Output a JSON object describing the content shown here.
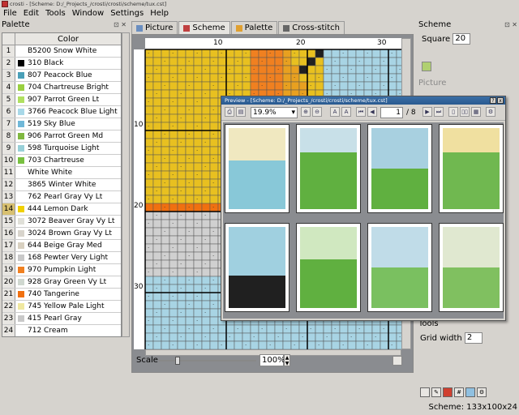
{
  "titlebar": {
    "text": "crosti - [Scheme: D:/_Projects_/crosti/crosti/scheme/tux.cst]"
  },
  "menu": [
    "File",
    "Edit",
    "Tools",
    "Window",
    "Settings",
    "Help"
  ],
  "palette": {
    "title": "Palette",
    "column_header": "Color",
    "selected_row": 14,
    "rows": [
      {
        "n": "1",
        "name": "B5200 Snow White",
        "color": ""
      },
      {
        "n": "2",
        "name": "310 Black",
        "color": "#000000"
      },
      {
        "n": "3",
        "name": "807 Peacock Blue",
        "color": "#4aa0b8"
      },
      {
        "n": "4",
        "name": "704 Chartreuse Bright",
        "color": "#9ad040"
      },
      {
        "n": "5",
        "name": "907 Parrot Green Lt",
        "color": "#b0e060"
      },
      {
        "n": "6",
        "name": "3766 Peacock Blue Light",
        "color": "#a8d8e8"
      },
      {
        "n": "7",
        "name": "519 Sky Blue",
        "color": "#70b8d8"
      },
      {
        "n": "8",
        "name": "906 Parrot Green Md",
        "color": "#80b840"
      },
      {
        "n": "9",
        "name": "598 Turquoise Light",
        "color": "#98d0d8"
      },
      {
        "n": "10",
        "name": "703 Chartreuse",
        "color": "#78c040"
      },
      {
        "n": "11",
        "name": "White White",
        "color": ""
      },
      {
        "n": "12",
        "name": "3865 Winter White",
        "color": ""
      },
      {
        "n": "13",
        "name": "762 Pearl Gray Vy Lt",
        "color": ""
      },
      {
        "n": "14",
        "name": "444 Lemon Dark",
        "color": "#f0d000"
      },
      {
        "n": "15",
        "name": "3072 Beaver Gray Vy Lt",
        "color": "#e0e0d8"
      },
      {
        "n": "16",
        "name": "3024 Brown Gray Vy Lt",
        "color": "#d8d4cc"
      },
      {
        "n": "17",
        "name": "644 Beige Gray Med",
        "color": "#d8d0c0"
      },
      {
        "n": "18",
        "name": "168 Pewter Very Light",
        "color": "#c8c8c8"
      },
      {
        "n": "19",
        "name": "970 Pumpkin Light",
        "color": "#f08020"
      },
      {
        "n": "20",
        "name": "928 Gray Green Vy Lt",
        "color": "#d0d8d0"
      },
      {
        "n": "21",
        "name": "740 Tangerine",
        "color": "#f07010"
      },
      {
        "n": "22",
        "name": "745 Yellow Pale Light",
        "color": "#f0e8a0"
      },
      {
        "n": "23",
        "name": "415 Pearl Gray",
        "color": "#c8c8c8"
      },
      {
        "n": "24",
        "name": "712 Cream",
        "color": ""
      }
    ]
  },
  "tabs": [
    {
      "label": "Picture",
      "icon": "picture-icon",
      "color": "#6a8ec0"
    },
    {
      "label": "Scheme",
      "icon": "scheme-icon",
      "color": "#c04040"
    },
    {
      "label": "Palette",
      "icon": "palette-icon",
      "color": "#e0a030"
    },
    {
      "label": "Cross-stitch",
      "icon": "cross-stitch-icon",
      "color": "#666666"
    }
  ],
  "active_tab": 1,
  "rulers": {
    "top": [
      "10",
      "20",
      "30"
    ],
    "left": [
      "10",
      "20",
      "30"
    ]
  },
  "scale": {
    "label": "Scale",
    "value": "100%"
  },
  "right": {
    "scheme_title": "Scheme",
    "square_label": "Square",
    "square_value": "20",
    "picture_title": "Picture",
    "tools_title": "Tools",
    "grid_width_label": "Grid width",
    "grid_width_value": "2"
  },
  "status": "Scheme: 133x100x24",
  "preview": {
    "title": "Preview - [Scheme: D:/_Projects_/crosti/crosti/scheme/tux.cst]",
    "zoom": "19.9%",
    "page": "1",
    "pages_total": "/ 8",
    "window_controls": [
      "?",
      "x"
    ]
  }
}
